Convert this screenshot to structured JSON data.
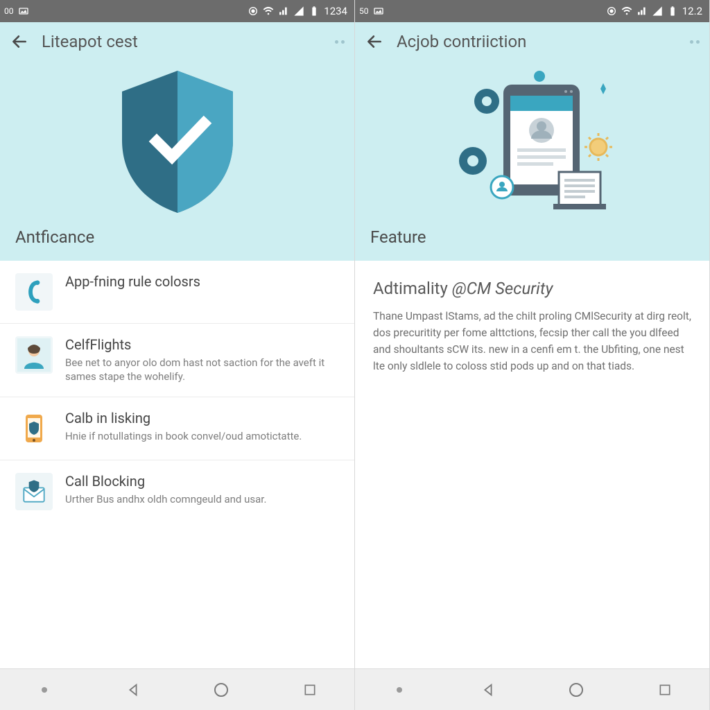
{
  "status": {
    "left_text": "00",
    "time": "1234",
    "right_time": "12.2"
  },
  "screens": [
    {
      "appbar": {
        "title": "Liteapot cest"
      },
      "hero": {
        "label": "Antficance"
      },
      "items": [
        {
          "title": "App-fning rule colosrs",
          "sub": ""
        },
        {
          "title": "CelfFlights",
          "sub": "Bee net to anyor olo dom hast not saction for the aveft it sames stape the wohelify."
        },
        {
          "title": "Calb in lisking",
          "sub": "Hnie if notullatings in book convel/oud amotictatte."
        },
        {
          "title": "Call Blocking",
          "sub": "Urther Bus andhx oldh comngeuld and usar."
        }
      ]
    },
    {
      "appbar": {
        "title": "Acjob contriiction"
      },
      "hero": {
        "label": "Feature"
      },
      "article": {
        "heading_plain": "Adtimality ",
        "heading_em": "@CM Security",
        "body": "Thane Umpast lStams, ad the chilt proling CMlSecurity at dirg reolt, dos precuritity per fome alttctions, fecsip ther call the you dlfeed and shoultants sCW its. new in a cenfi em t. the Ubfiting, one nest lte only sldlele to coloss stid pods up and on that tiads."
      }
    }
  ]
}
